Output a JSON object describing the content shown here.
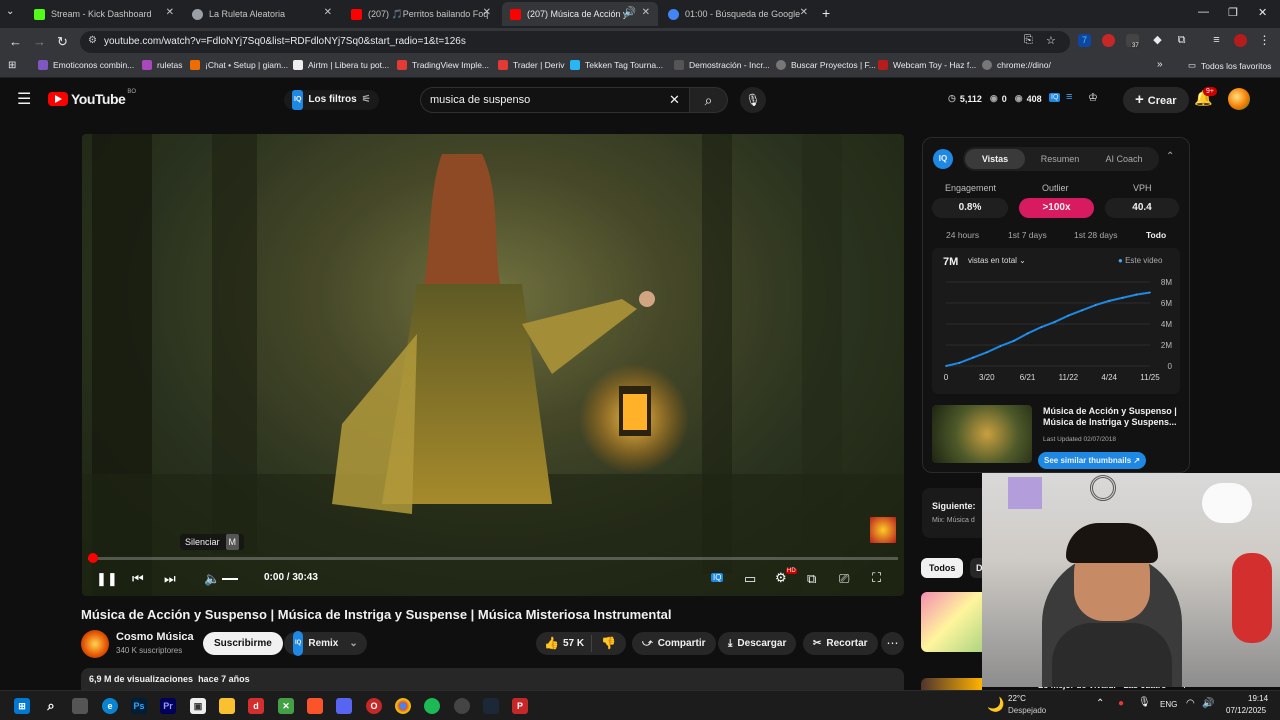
{
  "browser": {
    "tabs": [
      {
        "label": "Stream - Kick Dashboard",
        "color": "#53fc18"
      },
      {
        "label": "La Ruleta Aleatoria",
        "color": "#9aa0a6"
      },
      {
        "label": "(207) 🎵Perritos bailando Foqu",
        "color": "#ff0000"
      },
      {
        "label": "(207) Música de Acción y Su",
        "color": "#ff0000"
      },
      {
        "label": "01:00 - Búsqueda de Google",
        "color": "#4285f4"
      }
    ],
    "url": "youtube.com/watch?v=FdloNYj7Sq0&list=RDFdloNYj7Sq0&start_radio=1&t=126s",
    "ext_badge": "37",
    "bookmarks": [
      "Emoticonos combin...",
      "ruletas",
      "¡Chat • Setup | giam...",
      "Airtm | Libera tu pot...",
      "TradingView Imple...",
      "Trader | Deriv",
      "Tekken Tag Tourna...",
      "Demostración - Incr...",
      "Buscar Proyectos | F...",
      "Webcam Toy - Haz f...",
      "chrome://dino/"
    ],
    "all_bookmarks": "Todos los favoritos"
  },
  "yt": {
    "logo": "YouTube",
    "logo_region": "BO",
    "filters": "Los filtros",
    "search_value": "musica de suspenso",
    "stats": {
      "views": "5,112",
      "zero": "0",
      "count": "408"
    },
    "create": "Crear",
    "notif_badge": "9+"
  },
  "player": {
    "tooltip": "Silenciar",
    "tooltip_key": "M",
    "time": "0:00 / 30:43",
    "progress": 0.0,
    "settings_badge": "HD"
  },
  "video": {
    "title": "Música de Acción y Suspenso | Música de Instriga y Suspense | Música Misteriosa Instrumental",
    "channel": "Cosmo Música",
    "subs": "340 K suscriptores",
    "subscribe": "Suscribirme",
    "remix": "Remix",
    "likes": "57 K",
    "share": "Compartir",
    "download": "Descargar",
    "clip": "Recortar",
    "meta_views": "6,9 M de visualizaciones",
    "meta_date": "hace 7 años"
  },
  "iq": {
    "tabs": [
      "Vistas",
      "Resumen",
      "AI Coach"
    ],
    "metrics": [
      {
        "label": "Engagement",
        "value": "0.8%"
      },
      {
        "label": "Outlier",
        "value": ">100x"
      },
      {
        "label": "VPH",
        "value": "40.4"
      }
    ],
    "ranges": [
      "24 hours",
      "1st 7 days",
      "1st 28 days",
      "Todo"
    ],
    "total": "7M",
    "total_label": "vistas en total",
    "legend": "Este video",
    "accent": "#1e88e5",
    "outlier_color": "#d81b60",
    "thumb_title": "Música de Acción y Suspenso | Música de Instriga y Suspens...",
    "last_updated": "Last Updated 02/07/2018",
    "similar_btn": "See similar thumbnails"
  },
  "chart_data": {
    "type": "line",
    "title": "",
    "xlabel": "",
    "ylabel": "",
    "x_ticks": [
      "0",
      "3/20",
      "6/21",
      "11/22",
      "4/24",
      "11/25"
    ],
    "y_ticks": [
      "0",
      "2M",
      "4M",
      "6M",
      "8M"
    ],
    "ylim": [
      0,
      8000000
    ],
    "series": [
      {
        "name": "Este video",
        "values": [
          0,
          300000,
          800000,
          1300000,
          1900000,
          2400000,
          3100000,
          3700000,
          4200000,
          4800000,
          5300000,
          5800000,
          6200000,
          6500000,
          6800000,
          7000000
        ]
      }
    ],
    "grid": true
  },
  "next": {
    "label": "Siguiente:",
    "sub": "Mix: Música d",
    "chips": [
      "Todos",
      "D"
    ],
    "bottom_title": "Lo mejor de Vivaldi - Las cuatro"
  },
  "taskbar": {
    "temp": "22°C",
    "weather": "Despejado",
    "lang": "ENG",
    "time": "19:14",
    "date": "07/12/2025"
  }
}
